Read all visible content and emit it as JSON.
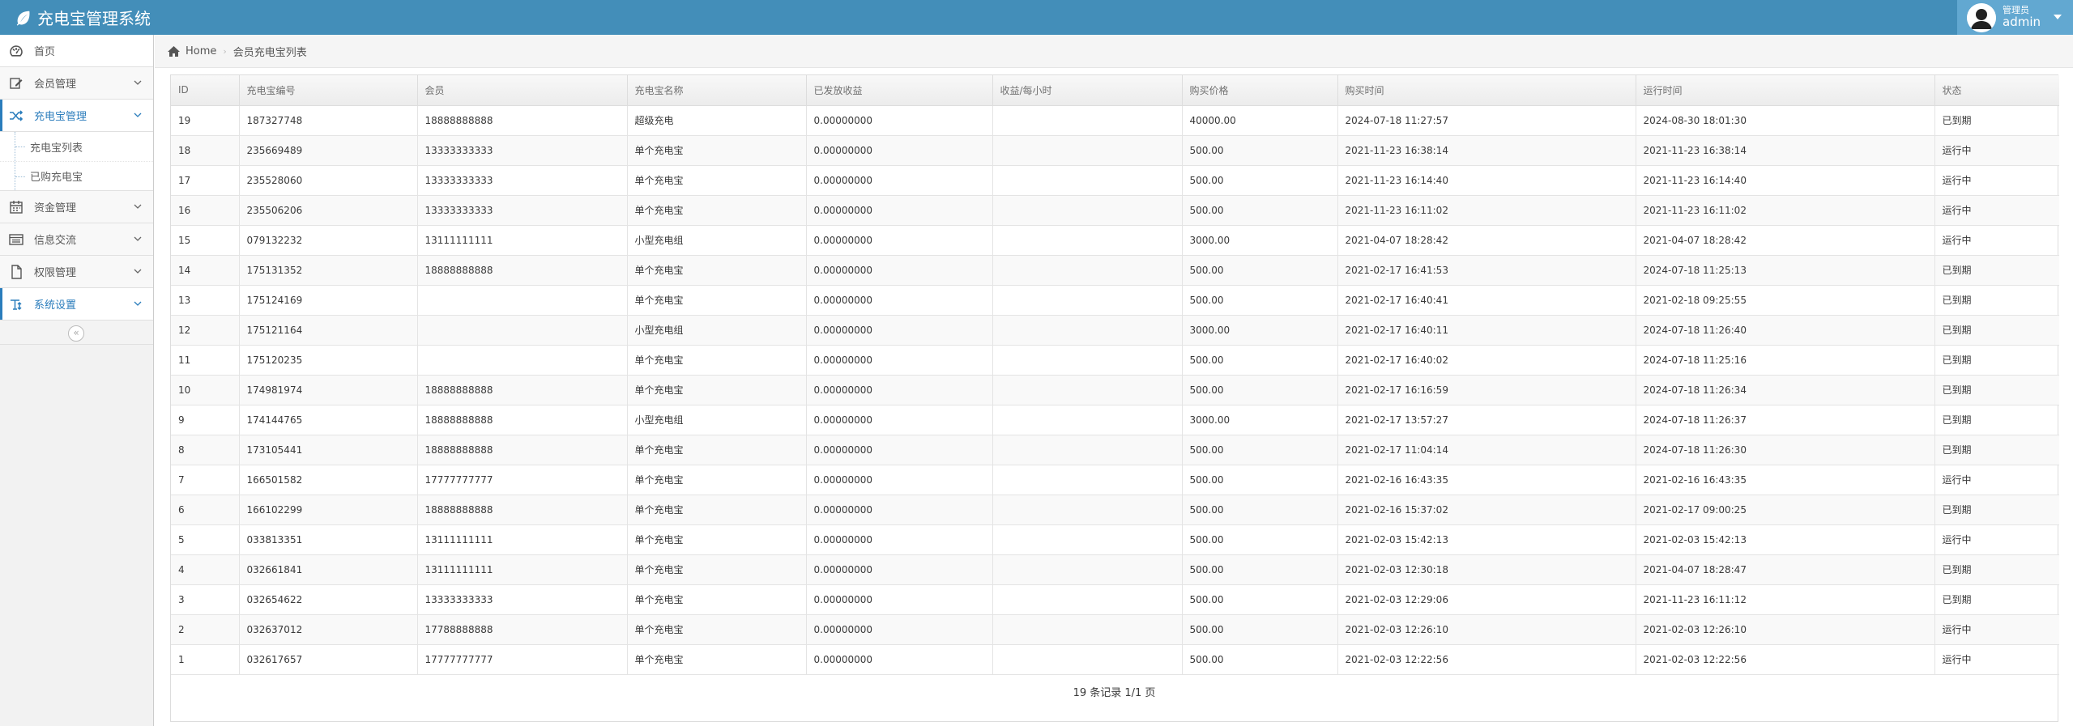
{
  "app": {
    "title": "充电宝管理系统",
    "brand_icon": "leaf-icon",
    "accent": "#438eb9"
  },
  "user": {
    "role": "管理员",
    "name": "admin"
  },
  "sidebar": {
    "items": [
      {
        "label": "首页",
        "icon": "dashboard-icon"
      },
      {
        "label": "会员管理",
        "icon": "edit-icon"
      },
      {
        "label": "充电宝管理",
        "icon": "random-icon"
      },
      {
        "label": "资金管理",
        "icon": "calendar-icon"
      },
      {
        "label": "信息交流",
        "icon": "list-icon"
      },
      {
        "label": "权限管理",
        "icon": "file-icon"
      },
      {
        "label": "系统设置",
        "icon": "text-icon"
      }
    ],
    "submenu": [
      {
        "label": "充电宝列表"
      },
      {
        "label": "已购充电宝"
      }
    ],
    "collapse_icon": "double-angle-left-icon"
  },
  "breadcrumb": {
    "home": "Home",
    "current": "会员充电宝列表"
  },
  "table": {
    "columns": [
      "ID",
      "充电宝编号",
      "会员",
      "充电宝名称",
      "已发放收益",
      "收益/每小时",
      "购买价格",
      "购买时间",
      "运行时间",
      "状态"
    ],
    "rows": [
      [
        "19",
        "187327748",
        "18888888888",
        "超级充电",
        "0.00000000",
        "",
        "40000.00",
        "2024-07-18 11:27:57",
        "2024-08-30 18:01:30",
        "已到期"
      ],
      [
        "18",
        "235669489",
        "13333333333",
        "单个充电宝",
        "0.00000000",
        "",
        "500.00",
        "2021-11-23 16:38:14",
        "2021-11-23 16:38:14",
        "运行中"
      ],
      [
        "17",
        "235528060",
        "13333333333",
        "单个充电宝",
        "0.00000000",
        "",
        "500.00",
        "2021-11-23 16:14:40",
        "2021-11-23 16:14:40",
        "运行中"
      ],
      [
        "16",
        "235506206",
        "13333333333",
        "单个充电宝",
        "0.00000000",
        "",
        "500.00",
        "2021-11-23 16:11:02",
        "2021-11-23 16:11:02",
        "运行中"
      ],
      [
        "15",
        "079132232",
        "13111111111",
        "小型充电组",
        "0.00000000",
        "",
        "3000.00",
        "2021-04-07 18:28:42",
        "2021-04-07 18:28:42",
        "运行中"
      ],
      [
        "14",
        "175131352",
        "18888888888",
        "单个充电宝",
        "0.00000000",
        "",
        "500.00",
        "2021-02-17 16:41:53",
        "2024-07-18 11:25:13",
        "已到期"
      ],
      [
        "13",
        "175124169",
        "",
        "单个充电宝",
        "0.00000000",
        "",
        "500.00",
        "2021-02-17 16:40:41",
        "2021-02-18 09:25:55",
        "已到期"
      ],
      [
        "12",
        "175121164",
        "",
        "小型充电组",
        "0.00000000",
        "",
        "3000.00",
        "2021-02-17 16:40:11",
        "2024-07-18 11:26:40",
        "已到期"
      ],
      [
        "11",
        "175120235",
        "",
        "单个充电宝",
        "0.00000000",
        "",
        "500.00",
        "2021-02-17 16:40:02",
        "2024-07-18 11:25:16",
        "已到期"
      ],
      [
        "10",
        "174981974",
        "18888888888",
        "单个充电宝",
        "0.00000000",
        "",
        "500.00",
        "2021-02-17 16:16:59",
        "2024-07-18 11:26:34",
        "已到期"
      ],
      [
        "9",
        "174144765",
        "18888888888",
        "小型充电组",
        "0.00000000",
        "",
        "3000.00",
        "2021-02-17 13:57:27",
        "2024-07-18 11:26:37",
        "已到期"
      ],
      [
        "8",
        "173105441",
        "18888888888",
        "单个充电宝",
        "0.00000000",
        "",
        "500.00",
        "2021-02-17 11:04:14",
        "2024-07-18 11:26:30",
        "已到期"
      ],
      [
        "7",
        "166501582",
        "17777777777",
        "单个充电宝",
        "0.00000000",
        "",
        "500.00",
        "2021-02-16 16:43:35",
        "2021-02-16 16:43:35",
        "运行中"
      ],
      [
        "6",
        "166102299",
        "18888888888",
        "单个充电宝",
        "0.00000000",
        "",
        "500.00",
        "2021-02-16 15:37:02",
        "2021-02-17 09:00:25",
        "已到期"
      ],
      [
        "5",
        "033813351",
        "13111111111",
        "单个充电宝",
        "0.00000000",
        "",
        "500.00",
        "2021-02-03 15:42:13",
        "2021-02-03 15:42:13",
        "运行中"
      ],
      [
        "4",
        "032661841",
        "13111111111",
        "单个充电宝",
        "0.00000000",
        "",
        "500.00",
        "2021-02-03 12:30:18",
        "2021-04-07 18:28:47",
        "已到期"
      ],
      [
        "3",
        "032654622",
        "13333333333",
        "单个充电宝",
        "0.00000000",
        "",
        "500.00",
        "2021-02-03 12:29:06",
        "2021-11-23 16:11:12",
        "已到期"
      ],
      [
        "2",
        "032637012",
        "17788888888",
        "单个充电宝",
        "0.00000000",
        "",
        "500.00",
        "2021-02-03 12:26:10",
        "2021-02-03 12:26:10",
        "运行中"
      ],
      [
        "1",
        "032617657",
        "17777777777",
        "单个充电宝",
        "0.00000000",
        "",
        "500.00",
        "2021-02-03 12:22:56",
        "2021-02-03 12:22:56",
        "运行中"
      ]
    ],
    "footer": "19 条记录 1/1 页"
  }
}
